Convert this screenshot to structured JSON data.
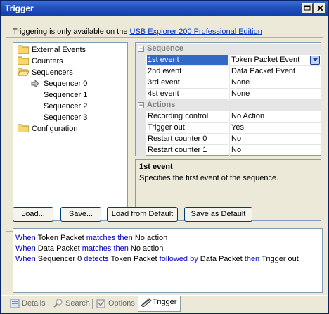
{
  "window": {
    "title": "Trigger"
  },
  "info": {
    "prefix": "Triggering is only available on the ",
    "link": "USB Explorer 200 Professional Edition"
  },
  "tree": {
    "items": [
      {
        "label": "External Events",
        "icon": "folder-icon"
      },
      {
        "label": "Counters",
        "icon": "folder-icon"
      },
      {
        "label": "Sequencers",
        "icon": "folder-open-icon"
      },
      {
        "label": "Sequencer 0",
        "icon": "arrow-right-icon",
        "selected": true
      },
      {
        "label": "Sequencer 1"
      },
      {
        "label": "Sequencer 2"
      },
      {
        "label": "Sequencer 3"
      },
      {
        "label": "Configuration",
        "icon": "folder-icon"
      }
    ]
  },
  "grid": {
    "categories": [
      {
        "name": "Sequence",
        "rows": [
          {
            "name": "1st event",
            "value": "Token Packet Event"
          },
          {
            "name": "2nd event",
            "value": "Data Packet Event"
          },
          {
            "name": "3rd event",
            "value": "None"
          },
          {
            "name": "4st event",
            "value": "None"
          }
        ]
      },
      {
        "name": "Actions",
        "rows": [
          {
            "name": "Recording control",
            "value": "No Action"
          },
          {
            "name": "Trigger out",
            "value": "Yes"
          },
          {
            "name": "Restart counter 0",
            "value": "No"
          },
          {
            "name": "Restart counter 1",
            "value": "No"
          }
        ]
      }
    ]
  },
  "description": {
    "title": "1st event",
    "text": "Specifies the first event of the sequence."
  },
  "buttons": {
    "load": "Load...",
    "save": "Save...",
    "load_default": "Load from Default",
    "save_default": "Save as Default"
  },
  "rules": [
    [
      {
        "t": "When",
        "k": true
      },
      {
        "t": " Token Packet ",
        "k": false
      },
      {
        "t": "matches",
        "k": true
      },
      {
        "t": " ",
        "k": false
      },
      {
        "t": "then",
        "k": true
      },
      {
        "t": " No action",
        "k": false
      }
    ],
    [
      {
        "t": "When",
        "k": true
      },
      {
        "t": " Data Packet ",
        "k": false
      },
      {
        "t": "matches",
        "k": true
      },
      {
        "t": " ",
        "k": false
      },
      {
        "t": "then",
        "k": true
      },
      {
        "t": " No action",
        "k": false
      }
    ],
    [
      {
        "t": "When",
        "k": true
      },
      {
        "t": " Sequencer 0 ",
        "k": false
      },
      {
        "t": "detects",
        "k": true
      },
      {
        "t": " Token Packet ",
        "k": false
      },
      {
        "t": "followed by",
        "k": true
      },
      {
        "t": " Data Packet ",
        "k": false
      },
      {
        "t": "then",
        "k": true
      },
      {
        "t": " Trigger out",
        "k": false
      }
    ]
  ],
  "tabs": [
    {
      "label": "Details",
      "icon": "details-icon"
    },
    {
      "label": "Search",
      "icon": "search-icon"
    },
    {
      "label": "Options",
      "icon": "options-icon"
    },
    {
      "label": "Trigger",
      "icon": "trigger-icon",
      "active": true
    }
  ],
  "colors": {
    "keyword": "#0000c0",
    "selection": "#316ac5",
    "titlebar": "#2453c1"
  }
}
